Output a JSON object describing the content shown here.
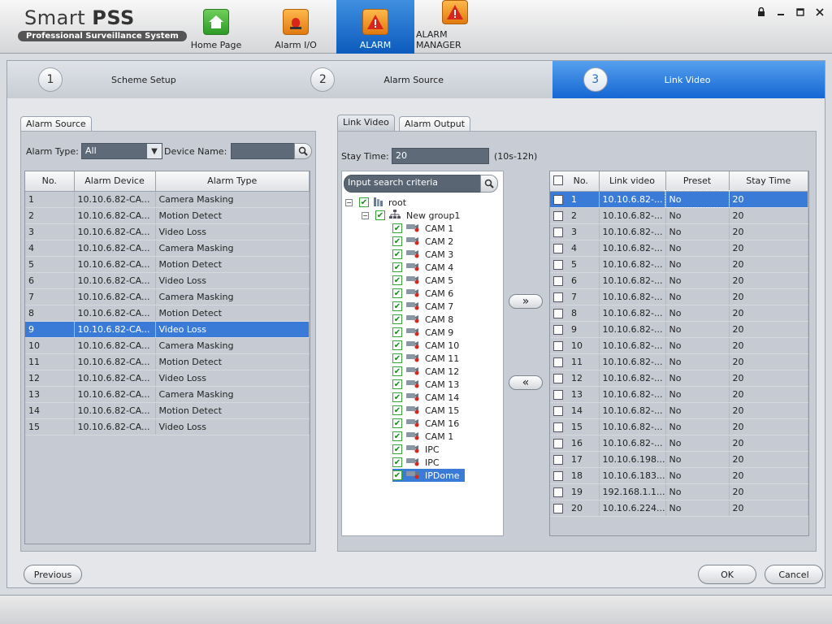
{
  "app": {
    "title_plain": "Smart",
    "title_bold": "PSS",
    "subtitle": "Professional Surveillance System"
  },
  "nav": [
    {
      "label": "Home Page",
      "icon": "home-icon",
      "active": false
    },
    {
      "label": "Alarm I/O",
      "icon": "alarm-light-icon",
      "active": false
    },
    {
      "label": "ALARM",
      "icon": "alarm-settings-icon",
      "active": true
    },
    {
      "label": "ALARM MANAGER",
      "icon": "warning-icon",
      "active": false
    }
  ],
  "steps": [
    {
      "num": "1",
      "label": "Scheme Setup"
    },
    {
      "num": "2",
      "label": "Alarm Source"
    },
    {
      "num": "3",
      "label": "Link Video",
      "active": true
    }
  ],
  "left": {
    "tab": "Alarm Source",
    "alarm_type_label": "Alarm Type:",
    "alarm_type_value": "All",
    "device_name_label": "Device Name:",
    "device_name_value": "",
    "columns": [
      "No.",
      "Alarm Device",
      "Alarm Type"
    ],
    "rows": [
      [
        "1",
        "10.10.6.82-CA...",
        "Camera Masking"
      ],
      [
        "2",
        "10.10.6.82-CA...",
        "Motion Detect"
      ],
      [
        "3",
        "10.10.6.82-CA...",
        "Video Loss"
      ],
      [
        "4",
        "10.10.6.82-CA...",
        "Camera Masking"
      ],
      [
        "5",
        "10.10.6.82-CA...",
        "Motion Detect"
      ],
      [
        "6",
        "10.10.6.82-CA...",
        "Video Loss"
      ],
      [
        "7",
        "10.10.6.82-CA...",
        "Camera Masking"
      ],
      [
        "8",
        "10.10.6.82-CA...",
        "Motion Detect"
      ],
      [
        "9",
        "10.10.6.82-CA...",
        "Video Loss"
      ],
      [
        "10",
        "10.10.6.82-CA...",
        "Camera Masking"
      ],
      [
        "11",
        "10.10.6.82-CA...",
        "Motion Detect"
      ],
      [
        "12",
        "10.10.6.82-CA...",
        "Video Loss"
      ],
      [
        "13",
        "10.10.6.82-CA...",
        "Camera Masking"
      ],
      [
        "14",
        "10.10.6.82-CA...",
        "Motion Detect"
      ],
      [
        "15",
        "10.10.6.82-CA...",
        "Video Loss"
      ]
    ],
    "selected_row": 8
  },
  "right": {
    "tabs": [
      "Link Video",
      "Alarm Output"
    ],
    "stay_time_label": "Stay Time:",
    "stay_time_value": "20",
    "stay_time_hint": "(10s-12h)",
    "search_placeholder": "Input search criteria",
    "tree": {
      "root": "root",
      "group": "New group1",
      "items": [
        "CAM 1",
        "CAM 2",
        "CAM 3",
        "CAM 4",
        "CAM 5",
        "CAM 6",
        "CAM 7",
        "CAM 8",
        "CAM 9",
        "CAM 10",
        "CAM 11",
        "CAM 12",
        "CAM 13",
        "CAM 14",
        "CAM 15",
        "CAM 16",
        "CAM 1",
        "IPC",
        "IPC",
        "IPDome"
      ],
      "selected": 19
    },
    "add_button": "»",
    "remove_button": "«",
    "columns": [
      "No.",
      "Link video",
      "Preset",
      "Stay Time"
    ],
    "rows": [
      [
        "1",
        "10.10.6.82-...",
        "No",
        "20"
      ],
      [
        "2",
        "10.10.6.82-...",
        "No",
        "20"
      ],
      [
        "3",
        "10.10.6.82-...",
        "No",
        "20"
      ],
      [
        "4",
        "10.10.6.82-...",
        "No",
        "20"
      ],
      [
        "5",
        "10.10.6.82-...",
        "No",
        "20"
      ],
      [
        "6",
        "10.10.6.82-...",
        "No",
        "20"
      ],
      [
        "7",
        "10.10.6.82-...",
        "No",
        "20"
      ],
      [
        "8",
        "10.10.6.82-...",
        "No",
        "20"
      ],
      [
        "9",
        "10.10.6.82-...",
        "No",
        "20"
      ],
      [
        "10",
        "10.10.6.82-...",
        "No",
        "20"
      ],
      [
        "11",
        "10.10.6.82-...",
        "No",
        "20"
      ],
      [
        "12",
        "10.10.6.82-...",
        "No",
        "20"
      ],
      [
        "13",
        "10.10.6.82-...",
        "No",
        "20"
      ],
      [
        "14",
        "10.10.6.82-...",
        "No",
        "20"
      ],
      [
        "15",
        "10.10.6.82-...",
        "No",
        "20"
      ],
      [
        "16",
        "10.10.6.82-...",
        "No",
        "20"
      ],
      [
        "17",
        "10.10.6.198...",
        "No",
        "20"
      ],
      [
        "18",
        "10.10.6.183...",
        "No",
        "20"
      ],
      [
        "19",
        "192.168.1.1...",
        "No",
        "20"
      ],
      [
        "20",
        "10.10.6.224...",
        "No",
        "20"
      ]
    ],
    "selected_row": 0
  },
  "buttons": {
    "previous": "Previous",
    "ok": "OK",
    "cancel": "Cancel"
  },
  "colors": {
    "accent": "#1466d3",
    "selection": "#3b7bd8"
  }
}
